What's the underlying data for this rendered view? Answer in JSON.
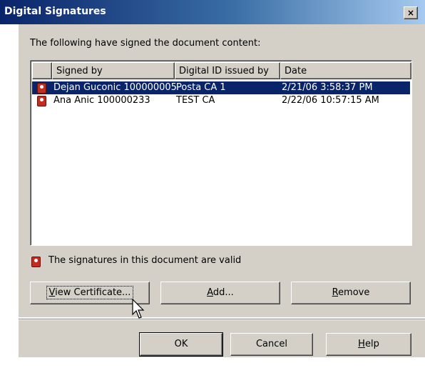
{
  "window": {
    "title": "Digital Signatures",
    "close_label": "×"
  },
  "intro": "The following have signed the document content:",
  "list": {
    "columns": [
      "",
      "Signed by",
      "Digital ID issued by",
      "Date"
    ],
    "rows": [
      {
        "signed_by": "Dejan Guconic 100000005",
        "issuer": "Posta CA 1",
        "date": "2/21/06 3:58:37 PM",
        "selected": true
      },
      {
        "signed_by": "Ana Anic 100000233",
        "issuer": "TEST CA",
        "date": "2/22/06 10:57:15 AM",
        "selected": false
      }
    ]
  },
  "status": {
    "text": "The signatures in this document are valid",
    "icon": "signature-icon"
  },
  "buttons": {
    "view_certificate": {
      "mnemonic": "V",
      "rest": "iew Certificate..."
    },
    "add": {
      "mnemonic": "A",
      "rest": "dd..."
    },
    "remove": {
      "mnemonic": "R",
      "rest": "emove"
    },
    "ok": "OK",
    "cancel": "Cancel",
    "help": {
      "mnemonic": "H",
      "rest": "elp"
    }
  },
  "colors": {
    "selection": "#0a246a",
    "face": "#d4d0c8",
    "signature_red": "#c62b1f"
  }
}
